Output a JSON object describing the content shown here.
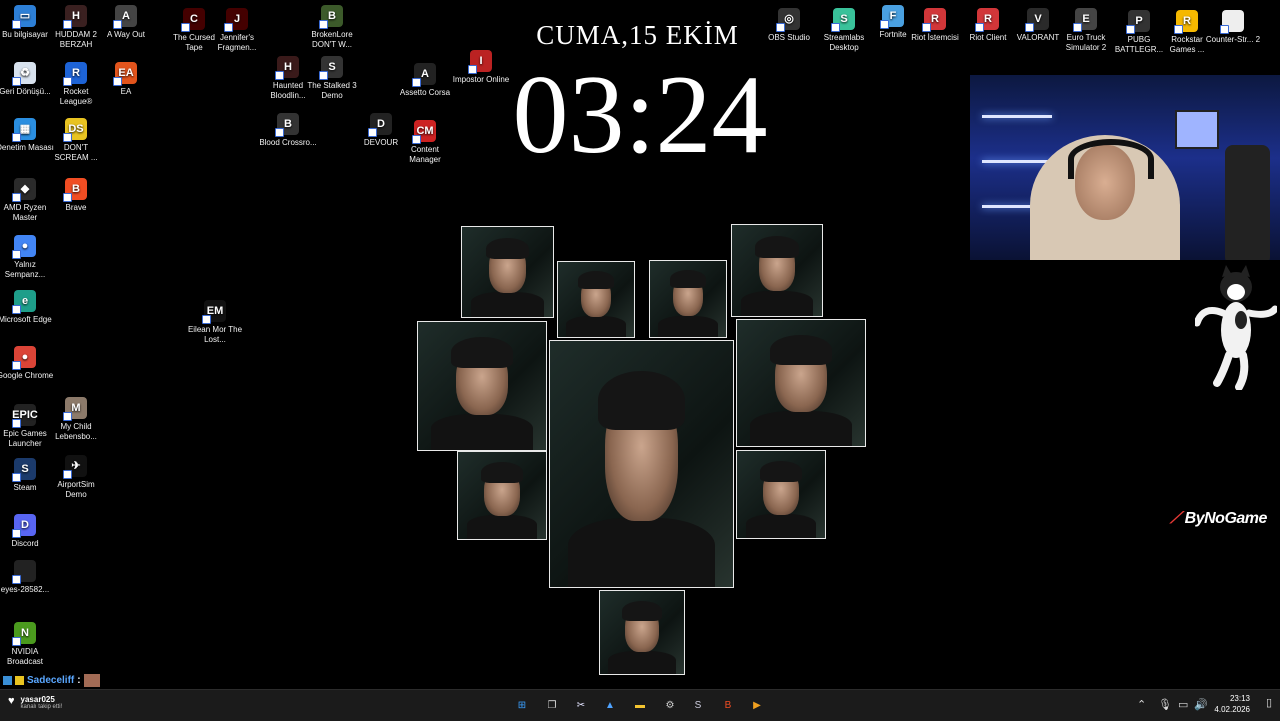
{
  "desktop_icons": [
    {
      "label": "Bu bilgisayar",
      "color": "#2d7fd6",
      "glyph": "▭",
      "icon": "computer-icon"
    },
    {
      "label": "HUDDAM 2 BERZAH",
      "color": "#3a2020",
      "glyph": "H",
      "icon": "game-icon"
    },
    {
      "label": "A Way Out",
      "color": "#444",
      "glyph": "A",
      "icon": "game-icon"
    },
    {
      "label": "Geri Dönüşü...",
      "color": "#d8e2ee",
      "glyph": "♻",
      "icon": "recycle-bin-icon"
    },
    {
      "label": "Rocket League®",
      "color": "#1d63d6",
      "glyph": "R",
      "icon": "rocket-league-icon"
    },
    {
      "label": "EA",
      "color": "#e2541c",
      "glyph": "EA",
      "icon": "ea-icon"
    },
    {
      "label": "Denetim Masası",
      "color": "#2a8ee0",
      "glyph": "▦",
      "icon": "control-panel-icon"
    },
    {
      "label": "DON'T SCREAM ...",
      "color": "#e8c321",
      "glyph": "DS",
      "icon": "game-icon"
    },
    {
      "label": "AMD Ryzen Master",
      "color": "#2b2b2b",
      "glyph": "◆",
      "icon": "amd-icon"
    },
    {
      "label": "Brave",
      "color": "#f04d23",
      "glyph": "B",
      "icon": "brave-icon"
    },
    {
      "label": "Yalnız Sempanz...",
      "color": "#4285f4",
      "glyph": "●",
      "icon": "chrome-icon"
    },
    {
      "label": "Microsoft Edge",
      "color": "#1e9e8a",
      "glyph": "e",
      "icon": "edge-icon"
    },
    {
      "label": "Google Chrome",
      "color": "#db4437",
      "glyph": "●",
      "icon": "chrome-icon"
    },
    {
      "label": "Epic Games Launcher",
      "color": "#222",
      "glyph": "EPIC",
      "icon": "epic-games-icon"
    },
    {
      "label": "My Child Lebensbo...",
      "color": "#8c7a6a",
      "glyph": "M",
      "icon": "game-icon"
    },
    {
      "label": "Steam",
      "color": "#1b3a6b",
      "glyph": "S",
      "icon": "steam-icon"
    },
    {
      "label": "AirportSim Demo",
      "color": "#111",
      "glyph": "✈",
      "icon": "airplane-icon"
    },
    {
      "label": "Discord",
      "color": "#5865f2",
      "glyph": "D",
      "icon": "discord-icon"
    },
    {
      "label": "eyes-28582...",
      "color": "#222",
      "glyph": "",
      "icon": "file-icon"
    },
    {
      "label": "NVIDIA Broadcast",
      "color": "#4b9b1e",
      "glyph": "N",
      "icon": "nvidia-icon"
    },
    {
      "label": "The Cursed Tape",
      "color": "#400",
      "glyph": "C",
      "icon": "game-icon"
    },
    {
      "label": "Jennifer's Fragmen...",
      "color": "#400",
      "glyph": "J",
      "icon": "game-icon"
    },
    {
      "label": "BrokenLore DON'T W...",
      "color": "#3c5a2a",
      "glyph": "B",
      "icon": "game-icon"
    },
    {
      "label": "Haunted Bloodlin...",
      "color": "#3a1a1a",
      "glyph": "H",
      "icon": "game-icon"
    },
    {
      "label": "The Stalked 3 Demo",
      "color": "#333",
      "glyph": "S",
      "icon": "game-icon"
    },
    {
      "label": "Assetto Corsa",
      "color": "#222",
      "glyph": "A",
      "icon": "game-icon"
    },
    {
      "label": "Impostor Online",
      "color": "#b22",
      "glyph": "I",
      "icon": "game-icon"
    },
    {
      "label": "Blood Crossro...",
      "color": "#333",
      "glyph": "B",
      "icon": "game-icon"
    },
    {
      "label": "DEVOUR",
      "color": "#222",
      "glyph": "D",
      "icon": "game-icon"
    },
    {
      "label": "Content Manager",
      "color": "#c22",
      "glyph": "CM",
      "icon": "game-icon"
    },
    {
      "label": "Eilean Mor The Lost...",
      "color": "#111",
      "glyph": "EM",
      "icon": "game-icon"
    },
    {
      "label": "OBS Studio",
      "color": "#333",
      "glyph": "◎",
      "icon": "obs-icon"
    },
    {
      "label": "Streamlabs Desktop",
      "color": "#39c29a",
      "glyph": "S",
      "icon": "streamlabs-icon"
    },
    {
      "label": "Fortnite",
      "color": "#4aa0e0",
      "glyph": "F",
      "icon": "fortnite-icon"
    },
    {
      "label": "Riot İstemcisi",
      "color": "#d13639",
      "glyph": "R",
      "icon": "riot-icon"
    },
    {
      "label": "Riot Client",
      "color": "#d13639",
      "glyph": "R",
      "icon": "riot-icon"
    },
    {
      "label": "VALORANT",
      "color": "#2a2a2a",
      "glyph": "V",
      "icon": "valorant-icon"
    },
    {
      "label": "Euro Truck Simulator 2",
      "color": "#444",
      "glyph": "E",
      "icon": "game-icon"
    },
    {
      "label": "PUBG BATTLEGR...",
      "color": "#333",
      "glyph": "P",
      "icon": "game-icon"
    },
    {
      "label": "Rockstar Games ...",
      "color": "#f5b800",
      "glyph": "R",
      "icon": "rockstar-icon"
    },
    {
      "label": "Counter-Str... 2",
      "color": "#eee",
      "glyph": "",
      "icon": "file-icon"
    }
  ],
  "clock_widget": {
    "date": "CUMA,15 EKİM",
    "time": "03:24"
  },
  "brand": {
    "logo_text": "ByNoGame",
    "accent": "#e53935"
  },
  "chat": {
    "username": "Sadeceliff",
    "separator": ":"
  },
  "notification": {
    "user": "yasar025",
    "message": "kanalı takip etti!"
  },
  "taskbar": {
    "apps": [
      {
        "name": "windows-start-icon",
        "glyph": "⊞",
        "color": "#3aa0ff"
      },
      {
        "name": "task-view-icon",
        "glyph": "❐",
        "color": "#ddd"
      },
      {
        "name": "snipping-tool-icon",
        "glyph": "✂",
        "color": "#e4e4ff"
      },
      {
        "name": "photos-icon",
        "glyph": "▲",
        "color": "#4fa3ff"
      },
      {
        "name": "file-explorer-icon",
        "glyph": "▬",
        "color": "#f4c430"
      },
      {
        "name": "settings-icon",
        "glyph": "⚙",
        "color": "#ccc"
      },
      {
        "name": "steam-icon",
        "glyph": "S",
        "color": "#ccd"
      },
      {
        "name": "brave-icon",
        "glyph": "B",
        "color": "#f04d23"
      },
      {
        "name": "media-icon",
        "glyph": "▶",
        "color": "#f0a020"
      }
    ],
    "time": "23:13",
    "date": "4.02.2026"
  }
}
